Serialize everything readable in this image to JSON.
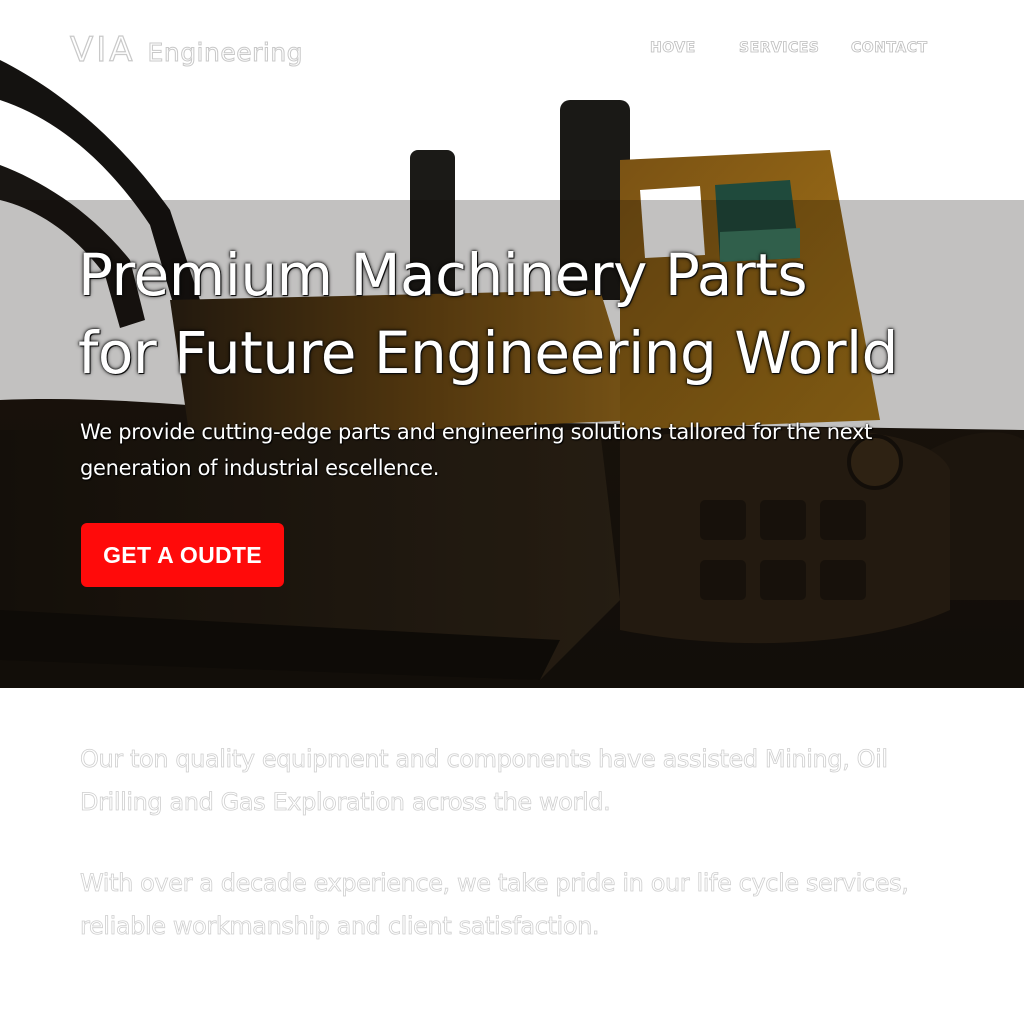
{
  "header": {
    "logo_mark": "VIA",
    "logo_word": "Engineering",
    "nav": [
      "HOVE",
      "SERVICES",
      "CONTACT"
    ]
  },
  "hero": {
    "title_lines": [
      "Premium Machinery Parts",
      "for Future Engineering World"
    ],
    "subtitle": "We provide cutting-edge parts and engineering solutions tallored for the next generation of industrial escellence.",
    "cta_label": "GET A OUDTE",
    "background_image": "bulldozer-photo"
  },
  "about": {
    "paragraphs": [
      "Our ton quality equipment and components have assisted Mining, Oil Drilling and Gas Exploration across the world.",
      "With over a decade experience, we take pride in our life cycle services, reliable workmanship and client satisfaction."
    ]
  },
  "colors": {
    "accent": "#ff0a0a",
    "hero_overlay": "#1a140d",
    "machine_yellow": "#8a5c14",
    "muted_text_stroke": "#cfcfcf"
  }
}
